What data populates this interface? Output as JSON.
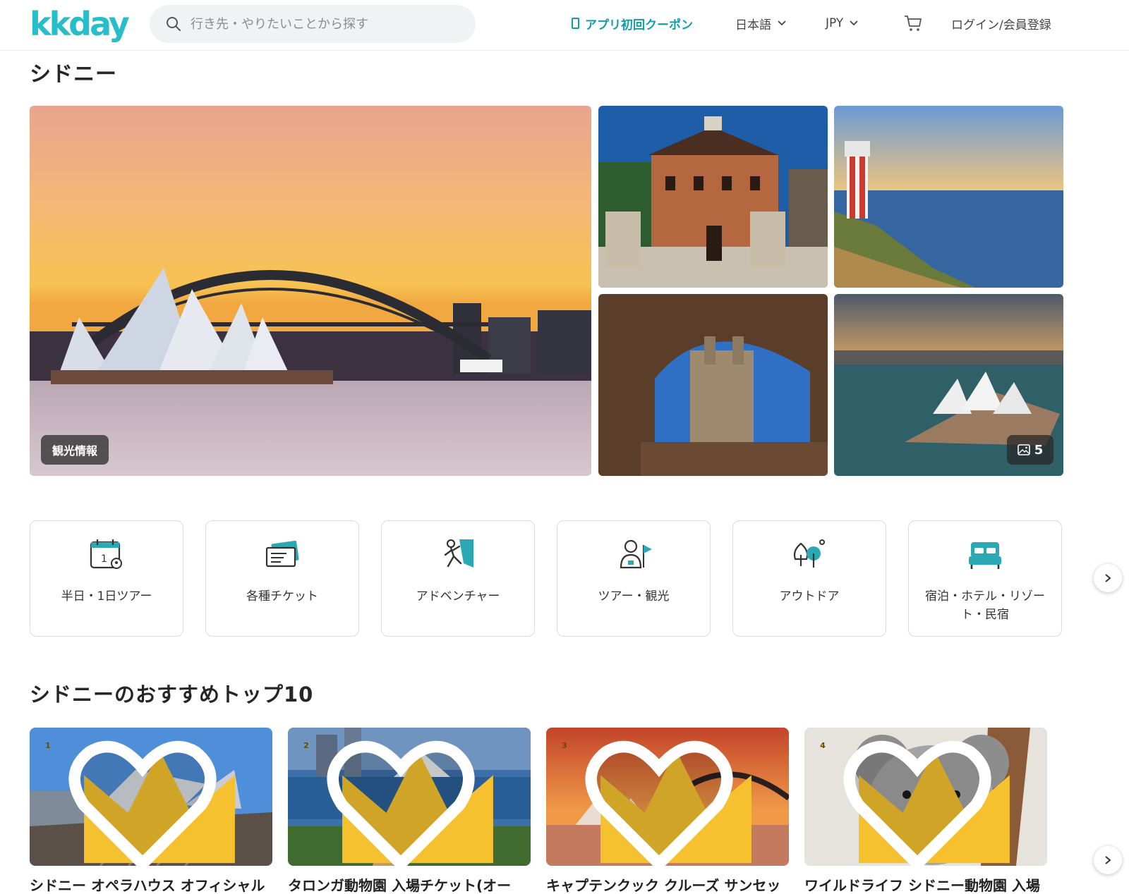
{
  "header": {
    "logo": "kkday",
    "search_placeholder": "行き先・やりたいことから探す",
    "coupon": "アプリ初回クーポン",
    "language": "日本語",
    "currency": "JPY",
    "login": "ログイン/会員登録"
  },
  "page": {
    "title": "シドニー"
  },
  "gallery": {
    "info_badge": "観光情報",
    "photo_count": "5"
  },
  "categories": [
    {
      "label": "半日・1日ツアー",
      "icon": "calendar-pin-icon"
    },
    {
      "label": "各種チケット",
      "icon": "ticket-icon"
    },
    {
      "label": "アドベンチャー",
      "icon": "climbing-icon"
    },
    {
      "label": "ツアー・観光",
      "icon": "tour-guide-icon"
    },
    {
      "label": "アウトドア",
      "icon": "trees-icon"
    },
    {
      "label": "宿泊・ホテル・リゾート・民宿",
      "icon": "bed-icon"
    }
  ],
  "top10": {
    "title": "シドニーのおすすめトップ10",
    "items": [
      {
        "rank": "1",
        "title": "シドニー オペラハウス オフィシャル"
      },
      {
        "rank": "2",
        "title": "タロンガ動物園 入場チケット(オー"
      },
      {
        "rank": "3",
        "title": "キャプテンクック クルーズ サンセッ"
      },
      {
        "rank": "4",
        "title": "ワイルドライフ シドニー動物園 入場"
      }
    ]
  },
  "colors": {
    "brand": "#26bec9",
    "coupon": "#139ea7",
    "icon_teal": "#2aa9b4"
  }
}
